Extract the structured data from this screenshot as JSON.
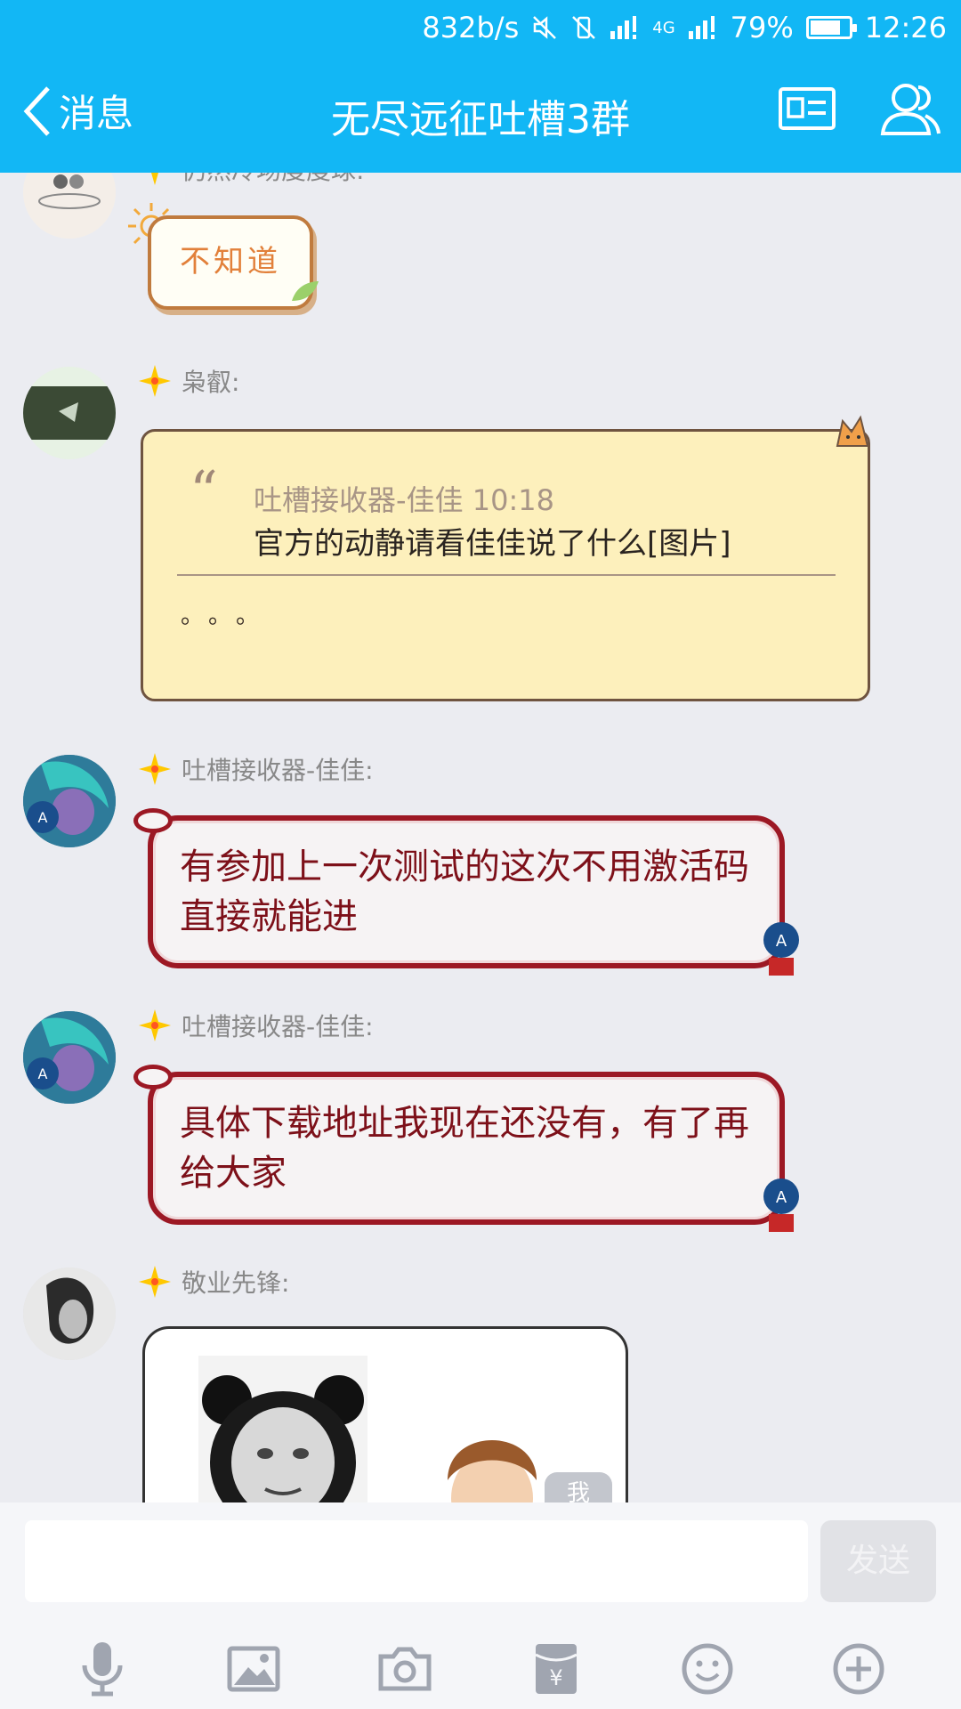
{
  "status_bar": {
    "speed": "832b/s",
    "network": "4G",
    "battery": "79%",
    "time": "12:26",
    "battery_level": 0.79
  },
  "header": {
    "back_label": "消息",
    "title": "无尽远征吐槽3群"
  },
  "messages": [
    {
      "sender": "仍然冷场度度球:",
      "text": "不知道"
    },
    {
      "sender": "枭叡:",
      "quote_meta": "吐槽接收器-佳佳 10:18",
      "quote_text": "官方的动静请看佳佳说了什么[图片]",
      "reply": "。。。"
    },
    {
      "sender": "吐槽接收器-佳佳:",
      "text": "有参加上一次测试的这次不用激活码直接就能进"
    },
    {
      "sender": "吐槽接收器-佳佳:",
      "text": "具体下载地址我现在还没有，有了再给大家"
    },
    {
      "sender": "敬业先锋:",
      "tag": "我"
    }
  ],
  "input": {
    "value": "",
    "send_label": "发送"
  },
  "tools": [
    "mic-icon",
    "image-icon",
    "camera-icon",
    "red-packet-icon",
    "emoji-icon",
    "plus-icon"
  ],
  "colors": {
    "header_bg": "#12b7f5",
    "chat_bg": "#ebecf1",
    "bubble_red_border": "#9c1824",
    "bubble_red_text": "#7d1019"
  }
}
